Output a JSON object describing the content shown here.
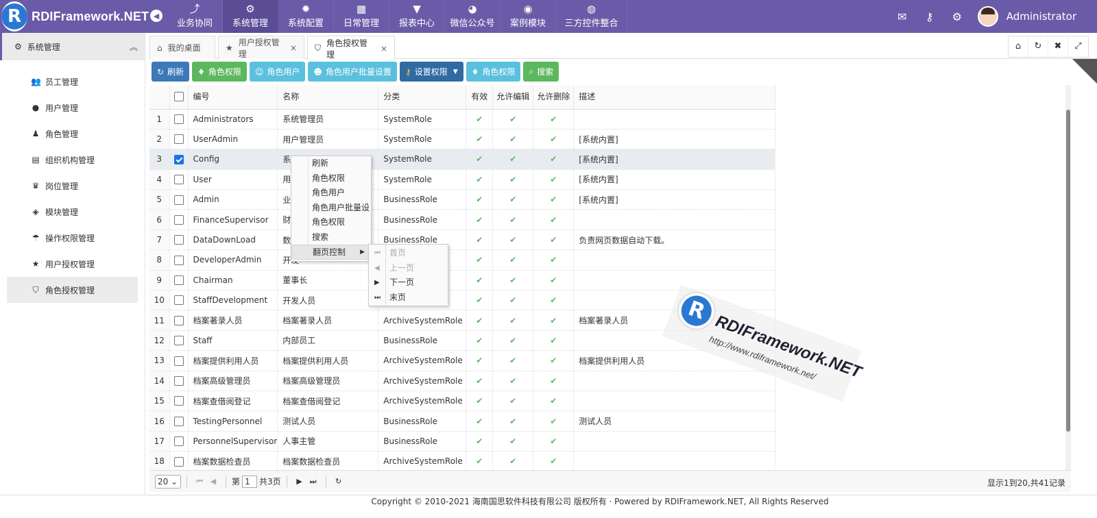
{
  "app": {
    "logo_letter": "R",
    "name": "RDIFramework.NET",
    "user": "Administrator"
  },
  "topnav": [
    {
      "label": "业务协同",
      "icon": "share-icon",
      "glyph": "⤴"
    },
    {
      "label": "系统管理",
      "icon": "gears-icon",
      "glyph": "⚙"
    },
    {
      "label": "系统配置",
      "icon": "gear-icon",
      "glyph": "✹"
    },
    {
      "label": "日常管理",
      "icon": "calendar-icon",
      "glyph": "▦"
    },
    {
      "label": "报表中心",
      "icon": "filter-icon",
      "glyph": "▼"
    },
    {
      "label": "微信公众号",
      "icon": "wechat-icon",
      "glyph": "◕"
    },
    {
      "label": "案例模块",
      "icon": "eye-icon",
      "glyph": "◉"
    },
    {
      "label": "三方控件整合",
      "icon": "globe-icon",
      "glyph": "◍"
    }
  ],
  "sidebar": {
    "title": "系统管理",
    "items": [
      {
        "label": "员工管理",
        "glyph": "👥"
      },
      {
        "label": "用户管理",
        "glyph": "●"
      },
      {
        "label": "角色管理",
        "glyph": "♟"
      },
      {
        "label": "组织机构管理",
        "glyph": "▤"
      },
      {
        "label": "岗位管理",
        "glyph": "♛"
      },
      {
        "label": "模块管理",
        "glyph": "◈"
      },
      {
        "label": "操作权限管理",
        "glyph": "☂"
      },
      {
        "label": "用户授权管理",
        "glyph": "★"
      },
      {
        "label": "角色授权管理",
        "glyph": "⛉"
      }
    ]
  },
  "tabs": [
    {
      "label": "我的桌面",
      "glyph": "⌂"
    },
    {
      "label": "用户授权管理",
      "glyph": "★",
      "close": "×"
    },
    {
      "label": "角色授权管理",
      "glyph": "⛉",
      "close": "×"
    }
  ],
  "toolbar": {
    "refresh": "刷新",
    "role_perm": "角色权限",
    "role_user": "角色用户",
    "role_user_batch": "角色用户批量设置",
    "set_perm": "设置权限",
    "role_perm2": "角色权限",
    "search": "搜索"
  },
  "columns": {
    "code": "编号",
    "name": "名称",
    "category": "分类",
    "enabled": "有效",
    "allow_edit": "允许编辑",
    "allow_delete": "允许删除",
    "desc": "描述"
  },
  "rows": [
    {
      "n": "1",
      "code": "Administrators",
      "name": "系统管理员",
      "cat": "SystemRole",
      "desc": ""
    },
    {
      "n": "2",
      "code": "UserAdmin",
      "name": "用户管理员",
      "cat": "SystemRole",
      "desc": "[系统内置]"
    },
    {
      "n": "3",
      "code": "Config",
      "name": "系统",
      "cat": "SystemRole",
      "desc": "[系统内置]"
    },
    {
      "n": "4",
      "code": "User",
      "name": "用户",
      "cat": "SystemRole",
      "desc": "[系统内置]"
    },
    {
      "n": "5",
      "code": "Admin",
      "name": "业务",
      "cat": "BusinessRole",
      "desc": "[系统内置]"
    },
    {
      "n": "6",
      "code": "FinanceSupervisor",
      "name": "财务",
      "cat": "BusinessRole",
      "desc": ""
    },
    {
      "n": "7",
      "code": "DataDownLoad",
      "name": "数据",
      "cat": "BusinessRole",
      "desc": "负责网页数据自动下载。"
    },
    {
      "n": "8",
      "code": "DeveloperAdmin",
      "name": "开发",
      "cat": "",
      "desc": ""
    },
    {
      "n": "9",
      "code": "Chairman",
      "name": "董事长",
      "cat": "",
      "desc": ""
    },
    {
      "n": "10",
      "code": "StaffDevelopment",
      "name": "开发人员",
      "cat": "",
      "desc": ""
    },
    {
      "n": "11",
      "code": "档案著录人员",
      "name": "档案著录人员",
      "cat": "ArchiveSystemRole",
      "desc": "档案著录人员"
    },
    {
      "n": "12",
      "code": "Staff",
      "name": "内部员工",
      "cat": "BusinessRole",
      "desc": ""
    },
    {
      "n": "13",
      "code": "档案提供利用人员",
      "name": "档案提供利用人员",
      "cat": "ArchiveSystemRole",
      "desc": "档案提供利用人员"
    },
    {
      "n": "14",
      "code": "档案高级管理员",
      "name": "档案高级管理员",
      "cat": "ArchiveSystemRole",
      "desc": ""
    },
    {
      "n": "15",
      "code": "档案查借阅登记",
      "name": "档案查借阅登记",
      "cat": "ArchiveSystemRole",
      "desc": ""
    },
    {
      "n": "16",
      "code": "TestingPersonnel",
      "name": "测试人员",
      "cat": "BusinessRole",
      "desc": "测试人员"
    },
    {
      "n": "17",
      "code": "PersonnelSupervisor",
      "name": "人事主管",
      "cat": "BusinessRole",
      "desc": ""
    },
    {
      "n": "18",
      "code": "档案数据检查员",
      "name": "档案数据检查员",
      "cat": "ArchiveSystemRole",
      "desc": ""
    }
  ],
  "check_mark": "✔",
  "context_menu": [
    "刷新",
    "角色权限",
    "角色用户",
    "角色用户批量设",
    "角色权限",
    "搜索",
    "翻页控制"
  ],
  "paging_menu": [
    "首页",
    "上一页",
    "下一页",
    "末页"
  ],
  "pager": {
    "page_size": "20",
    "page_prefix": "第",
    "page": "1",
    "page_suffix": "共3页",
    "info": "显示1到20,共41记录"
  },
  "footer": "Copyright © 2010-2021 海南国思软件科技有限公司 版权所有 · Powered by RDIFramework.NET, All Rights Reserved",
  "watermark": {
    "letter": "R",
    "title": "RDIFramework.NET",
    "url": "http://www.rdiframework.net/"
  }
}
